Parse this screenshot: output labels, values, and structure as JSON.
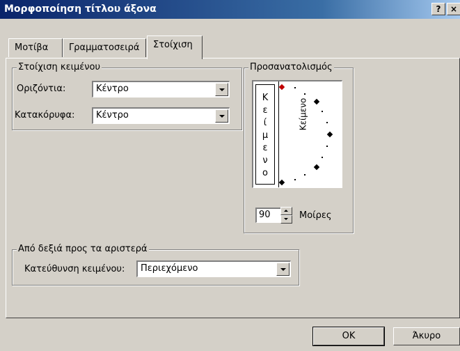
{
  "window": {
    "title": "Μορφοποίηση τίτλου άξονα",
    "help_btn": "?",
    "close_btn": "×"
  },
  "tabs": [
    {
      "label": "Μοτίβα",
      "selected": false
    },
    {
      "label": "Γραμματοσειρά",
      "selected": false
    },
    {
      "label": "Στοίχιση",
      "selected": true
    }
  ],
  "text_alignment": {
    "group_label": "Στοίχιση κειμένου",
    "horizontal_label": "Οριζόντια:",
    "horizontal_value": "Κέντρο",
    "vertical_label": "Κατακόρυφα:",
    "vertical_value": "Κέντρο"
  },
  "orientation": {
    "group_label": "Προσανατολισμός",
    "vertical_text": [
      "Κ",
      "ε",
      "ί",
      "μ",
      "ε",
      "ν",
      "ο"
    ],
    "rotated_text": "Κείμενο",
    "degrees_value": "90",
    "degrees_label": "Μοίρες"
  },
  "rtl": {
    "group_label": "Από δεξιά προς τα αριστερά",
    "direction_label": "Κατεύθυνση κειμένου:",
    "direction_value": "Περιεχόμενο"
  },
  "buttons": {
    "ok": "OK",
    "cancel": "Άκυρο"
  }
}
